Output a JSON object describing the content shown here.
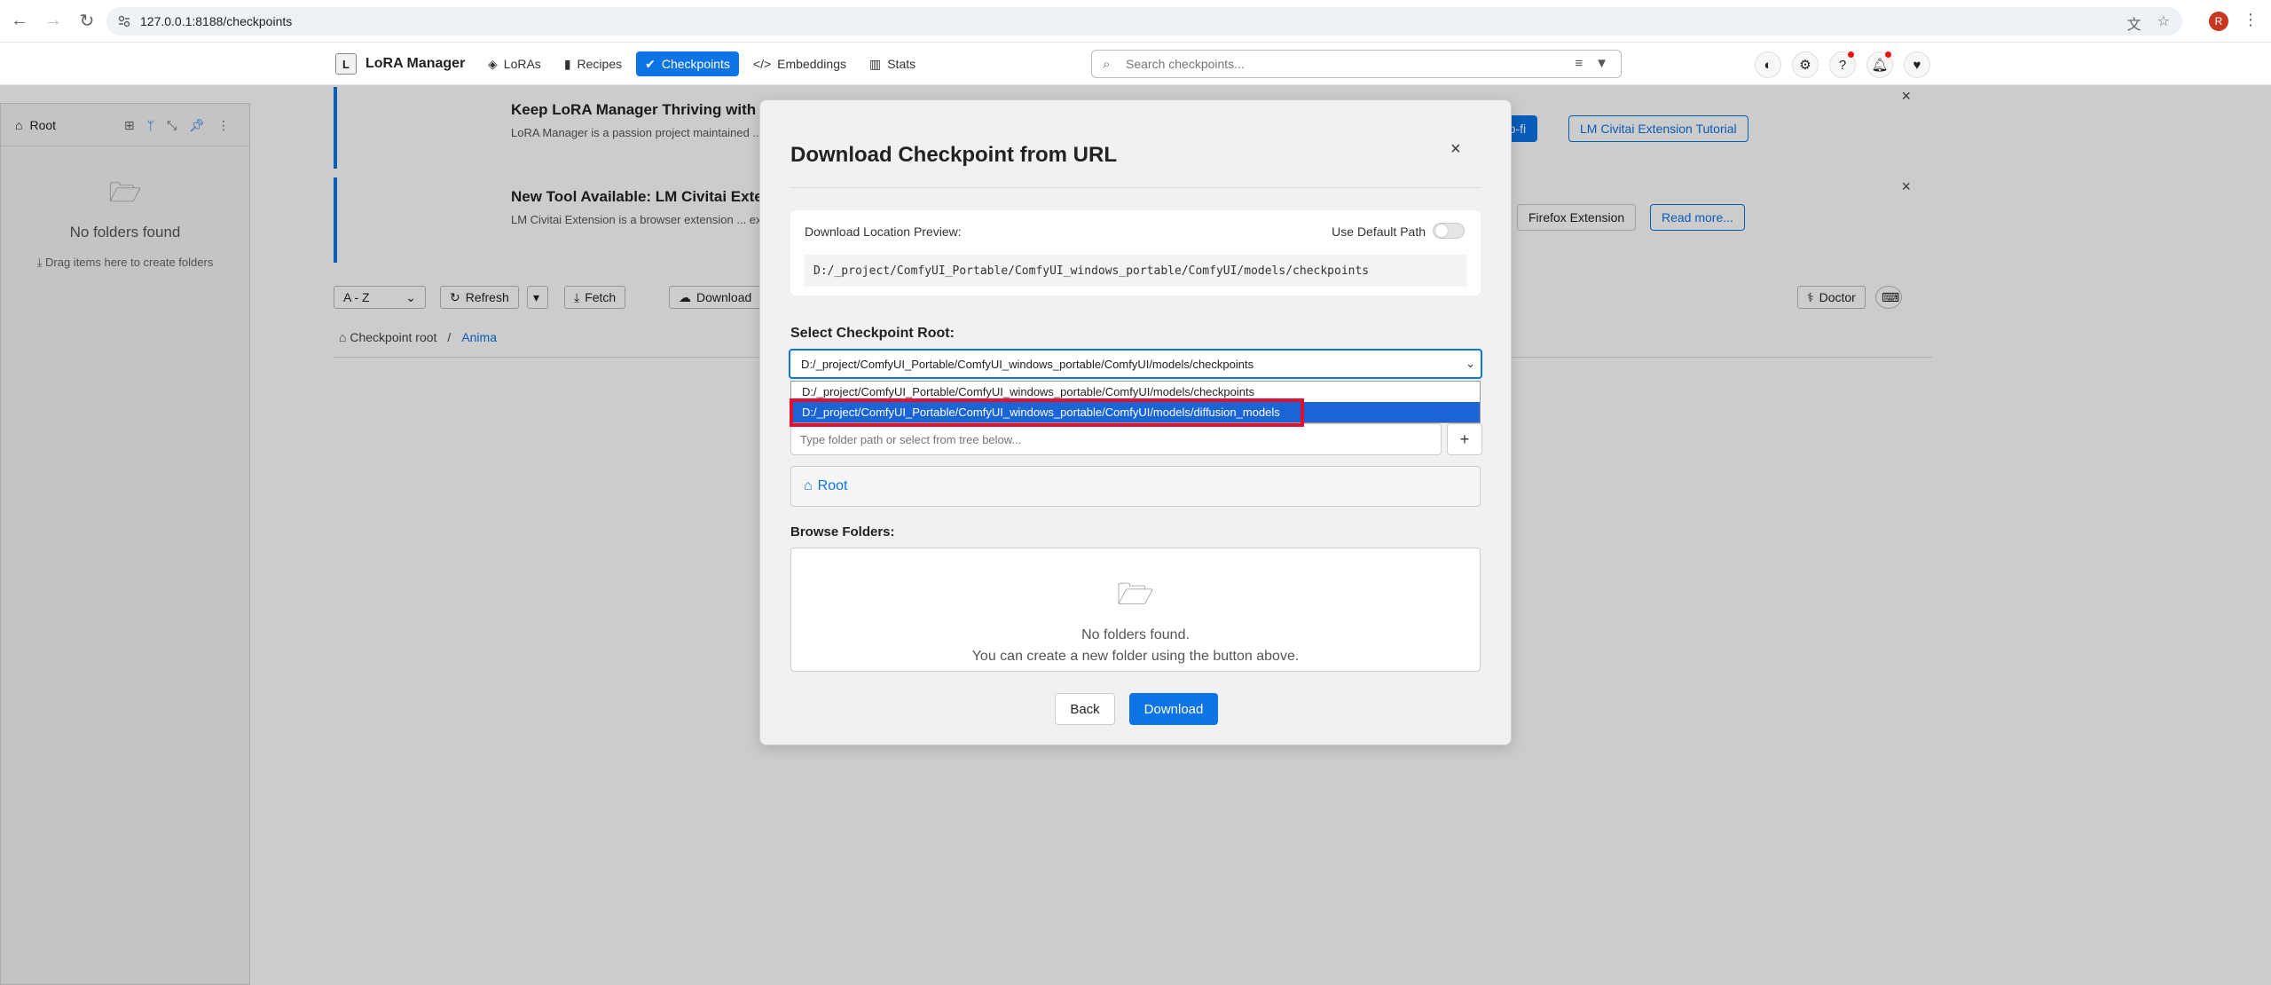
{
  "browser": {
    "url": "127.0.0.1:8188/checkpoints",
    "profile_initial": "R"
  },
  "app": {
    "logo_letter": "L",
    "name": "LoRA Manager",
    "tabs": [
      {
        "label": "LoRAs",
        "icon": "layers-icon"
      },
      {
        "label": "Recipes",
        "icon": "book-icon"
      },
      {
        "label": "Checkpoints",
        "icon": "check-circle-icon",
        "active": true
      },
      {
        "label": "Embeddings",
        "icon": "code-icon"
      },
      {
        "label": "Stats",
        "icon": "chart-icon"
      }
    ],
    "search_placeholder": "Search checkpoints...",
    "accent_color": "#0d74e8"
  },
  "sidebar": {
    "root_label": "Root",
    "empty_title": "No folders found",
    "empty_hint": "Drag items here to create folders"
  },
  "banners": [
    {
      "title": "Keep LoRA Manager Thriving with Your Support ❤",
      "body": "LoRA Manager is a passion project maintained ... coming, and unlocks a license key for the LM ...",
      "buttons": [
        "Support on Ko-fi",
        "LM Civitai Extension Tutorial"
      ]
    },
    {
      "title": "New Tool Available: LM Civitai Extension!",
      "body": "LM Civitai Extension is a browser extension ... experience! See which models you already h...",
      "buttons": [
        "Firefox Extension",
        "Read more..."
      ]
    }
  ],
  "controls": {
    "sort": "A - Z",
    "refresh": "Refresh",
    "fetch": "Fetch",
    "download": "Download",
    "doctor": "Doctor"
  },
  "breadcrumb": {
    "root": "Checkpoint root",
    "separator": "/",
    "current": "Anima"
  },
  "modal": {
    "title": "Download Checkpoint from URL",
    "preview_label": "Download Location Preview:",
    "default_path_label": "Use Default Path",
    "preview_path": "D:/_project/ComfyUI_Portable/ComfyUI_windows_portable/ComfyUI/models/checkpoints",
    "select_root_label": "Select Checkpoint Root:",
    "selected_root": "D:/_project/ComfyUI_Portable/ComfyUI_windows_portable/ComfyUI/models/checkpoints",
    "options": [
      "D:/_project/ComfyUI_Portable/ComfyUI_windows_portable/ComfyUI/models/checkpoints",
      "D:/_project/ComfyUI_Portable/ComfyUI_windows_portable/ComfyUI/models/diffusion_models"
    ],
    "folder_placeholder": "Type folder path or select from tree below...",
    "root_crumb": "Root",
    "browse_label": "Browse Folders:",
    "browse_empty_1": "No folders found.",
    "browse_empty_2": "You can create a new folder using the button above.",
    "back": "Back",
    "download": "Download"
  }
}
